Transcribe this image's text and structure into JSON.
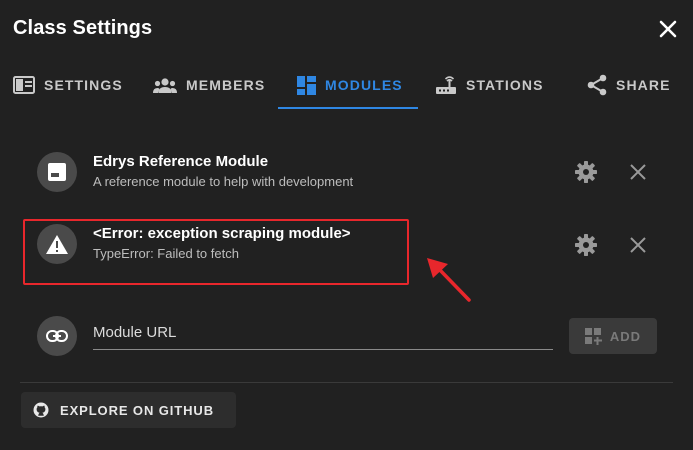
{
  "dialog": {
    "title": "Class Settings"
  },
  "tabs": [
    {
      "label": "SETTINGS",
      "icon": "settings-panel-icon",
      "active": false
    },
    {
      "label": "MEMBERS",
      "icon": "members-group-icon",
      "active": false
    },
    {
      "label": "MODULES",
      "icon": "modules-grid-icon",
      "active": true
    },
    {
      "label": "STATIONS",
      "icon": "station-router-icon",
      "active": false
    },
    {
      "label": "SHARE",
      "icon": "share-icon",
      "active": false
    }
  ],
  "modules": [
    {
      "title": "Edrys Reference Module",
      "subtitle": "A reference module to help with development",
      "icon": "module-window-icon"
    },
    {
      "title": "<Error: exception scraping module>",
      "subtitle": "TypeError: Failed to fetch",
      "icon": "warning-triangle-icon",
      "highlighted": true
    }
  ],
  "module_url": {
    "label": "Module URL",
    "icon": "link-icon",
    "add_label": "ADD",
    "add_enabled": false
  },
  "github": {
    "label": "EXPLORE ON GITHUB",
    "icon": "github-icon"
  },
  "colors": {
    "accent": "#2f87e3",
    "annotation": "#e8272c",
    "background": "#212121"
  }
}
